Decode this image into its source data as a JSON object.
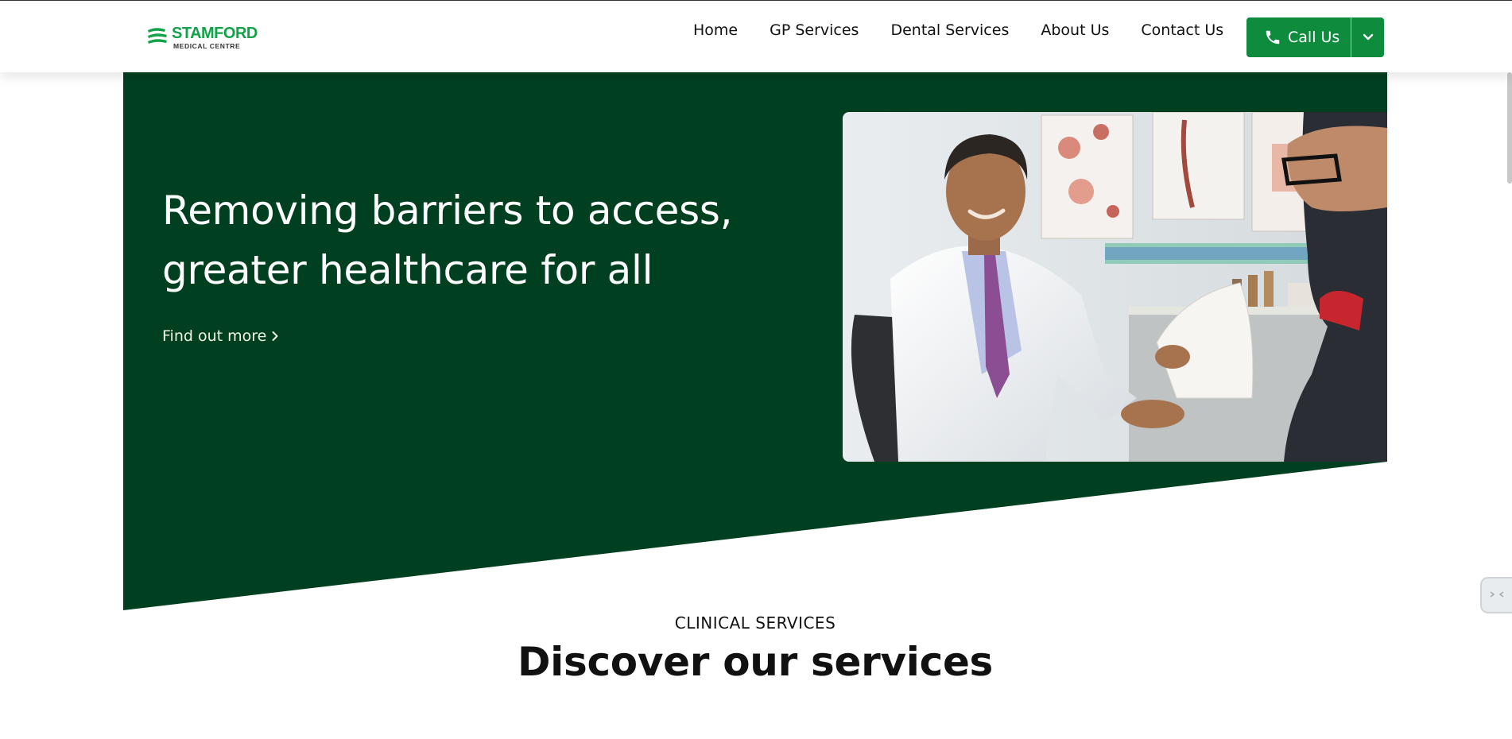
{
  "header": {
    "logo": {
      "name": "STAMFORD",
      "sub": "MEDICAL CENTRE",
      "icon": "stamford-logo-icon"
    },
    "nav": [
      {
        "label": "Home"
      },
      {
        "label": "GP Services"
      },
      {
        "label": "Dental Services"
      },
      {
        "label": "About Us"
      },
      {
        "label": "Contact Us"
      }
    ],
    "call": {
      "label": "Call Us",
      "icon": "phone-icon",
      "dropdown_icon": "chevron-down-icon"
    }
  },
  "hero": {
    "title": "Removing barriers to access, greater healthcare for all",
    "link_label": "Find out more",
    "link_icon": "chevron-right-icon",
    "image_icon": "doctor-consultation-photo"
  },
  "services": {
    "eyebrow": "CLINICAL SERVICES",
    "title": "Discover our services"
  },
  "colors": {
    "brand_green": "#13a14a",
    "button_green": "#0e8b3d",
    "hero_green": "#004020"
  }
}
